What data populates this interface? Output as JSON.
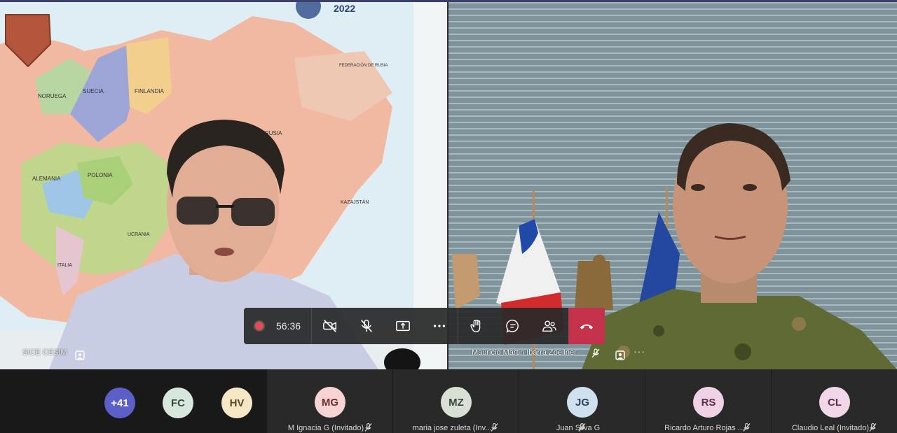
{
  "tiles": {
    "left": {
      "name": "SICE CESIM"
    },
    "right": {
      "name": "Mauricio Martin Ibarra Zoellner",
      "more": "···"
    }
  },
  "toolbar": {
    "timer": "56:36",
    "icons": [
      "camera-off-icon",
      "mic-off-icon",
      "share-screen-icon",
      "more-icon",
      "raise-hand-icon",
      "chat-icon",
      "participants-icon",
      "hang-up-icon"
    ]
  },
  "overflow": {
    "count": "+41",
    "avatars": [
      {
        "initials": "FC",
        "bg": "#d8e7de",
        "fg": "#2f4a3a"
      },
      {
        "initials": "HV",
        "bg": "#f5e6c6",
        "fg": "#5b4720"
      }
    ],
    "count_bg": "#5b5fc7"
  },
  "participants": [
    {
      "initials": "MG",
      "name": "M Ignacia G (Invitado)",
      "bg": "#f7d3d3",
      "fg": "#6a2f2f"
    },
    {
      "initials": "MZ",
      "name": "maria jose zuleta (Inv...",
      "bg": "#d8e0d4",
      "fg": "#39483a"
    },
    {
      "initials": "JG",
      "name": "Juan Silva G",
      "bg": "#cfe0ee",
      "fg": "#2d4560"
    },
    {
      "initials": "RS",
      "name": "Ricardo Arturo Rojas ...",
      "bg": "#efd3e4",
      "fg": "#5b2d48"
    },
    {
      "initials": "CL",
      "name": "Claudio Leal (Invitado)",
      "bg": "#f1d7e8",
      "fg": "#5c2d4c"
    }
  ],
  "video_labels": {
    "map_year": "2022",
    "map_regions": [
      "FINLANDIA",
      "SUECIA",
      "NORUEGA",
      "POLONIA",
      "ALEMANIA",
      "RUSIA",
      "FEDERACIÓN DE RUSIA",
      "KAZAJSTÁN",
      "ITALIA",
      "UCRANIA"
    ]
  }
}
